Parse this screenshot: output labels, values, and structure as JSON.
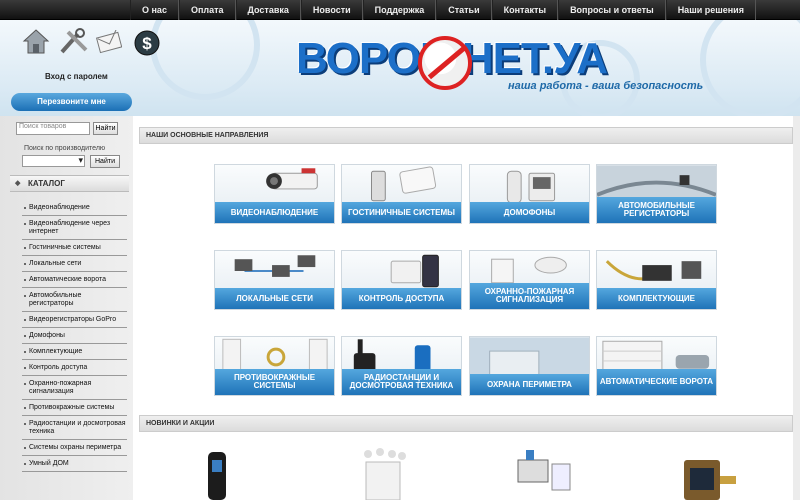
{
  "nav": {
    "items": [
      "О нас",
      "Оплата",
      "Доставка",
      "Новости",
      "Поддержка",
      "Статьи",
      "Контакты",
      "Вопросы и ответы",
      "Наши решения"
    ]
  },
  "header": {
    "logo": "ВОРОВ.НЕТ.УА",
    "slogan": "наша работа - ваша безопасность",
    "login": "Вход с паролем",
    "callback": "Перезвоните мне"
  },
  "sidebar": {
    "search_placeholder": "Поиск товаров",
    "find_label": "Найти",
    "manufacturer_label": "Поиск по производителю",
    "catalog_title": "КАТАЛОГ",
    "catalog": [
      "Видеонаблюдение",
      "Видеонаблюдение через интернет",
      "Гостиничные системы",
      "Локальные сети",
      "Автоматические ворота",
      "Автомобильные регистраторы",
      "Видеорегистраторы GoPro",
      "Домофоны",
      "Комплектующие",
      "Контроль доступа",
      "Охранно-пожарная сигнализация",
      "Противокражные системы",
      "Радиостанции и досмотровая техника",
      "Системы охраны периметра",
      "Умный ДОМ"
    ]
  },
  "main": {
    "directions_title": "НАШИ ОСНОВНЫЕ НАПРАВЛЕНИЯ",
    "tiles": [
      "ВИДЕОНАБЛЮДЕНИЕ",
      "ГОСТИНИЧНЫЕ СИСТЕМЫ",
      "ДОМОФОНЫ",
      "АВТОМОБИЛЬНЫЕ РЕГИСТРАТОРЫ",
      "ЛОКАЛЬНЫЕ СЕТИ",
      "КОНТРОЛЬ ДОСТУПА",
      "ОХРАННО-ПОЖАРНАЯ СИГНАЛИЗАЦИЯ",
      "КОМПЛЕКТУЮЩИЕ",
      "ПРОТИВОКРАЖНЫЕ СИСТЕМЫ",
      "РАДИОСТАНЦИИ И ДОСМОТРОВАЯ ТЕХНИКА",
      "ОХРАНА ПЕРИМЕТРА",
      "АВТОМАТИЧЕСКИЕ ВОРОТА"
    ],
    "news_title": "НОВИНКИ И АКЦИИ"
  },
  "colors": {
    "accent": "#1f73b8",
    "nav_bg": "#1a1a1a",
    "logo": "#1c6fc8",
    "logo_mark": "#d22222"
  }
}
